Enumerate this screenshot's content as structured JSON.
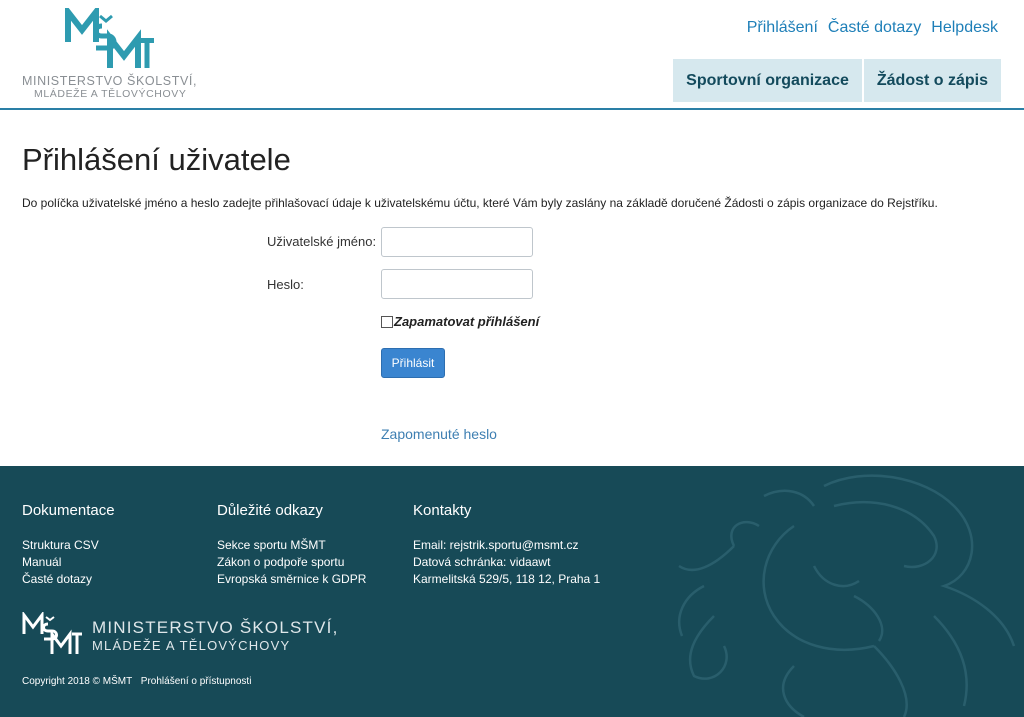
{
  "colors": {
    "accent": "#2a7fa6",
    "tab_bg": "#d6e8ee",
    "tab_text": "#134a5c",
    "button": "#3a85d0",
    "footer_bg": "#174a57"
  },
  "logo": {
    "mark_text": "MŠMT",
    "line1": "MINISTERSTVO ŠKOLSTVÍ,",
    "line2": "MLÁDEŽE A TĚLOVÝCHOVY"
  },
  "top_links": [
    "Přihlášení",
    "Časté dotazy",
    "Helpdesk"
  ],
  "tabs": [
    "Sportovní organizace",
    "Žádost o zápis"
  ],
  "main": {
    "title": "Přihlášení uživatele",
    "intro": "Do políčka uživatelské jméno a heslo zadejte přihlašovací údaje k uživatelskému účtu, které Vám byly zaslány na základě doručené Žádosti o zápis organizace do Rejstříku.",
    "username_label": "Uživatelské jméno:",
    "username_value": "",
    "password_label": "Heslo:",
    "password_value": "",
    "remember_label": "Zapamatovat přihlášení",
    "remember_checked": false,
    "login_button": "Přihlásit",
    "forgot_link": "Zapomenuté heslo"
  },
  "footer": {
    "columns": [
      {
        "heading": "Dokumentace",
        "links": [
          "Struktura CSV",
          "Manuál",
          "Časté dotazy"
        ]
      },
      {
        "heading": "Důležité odkazy",
        "links": [
          "Sekce sportu MŠMT",
          "Zákon o podpoře sportu",
          "Evropská směrnice k GDPR"
        ]
      },
      {
        "heading": "Kontakty",
        "links": [
          "Email: rejstrik.sportu@msmt.cz",
          "Datová schránka: vidaawt",
          "Karmelitská 529/5, 118 12, Praha 1"
        ]
      }
    ],
    "logo_line1": "MINISTERSTVO ŠKOLSTVÍ,",
    "logo_line2": "MLÁDEŽE A TĚLOVÝCHOVY",
    "copyright": "Copyright 2018 © MŠMT",
    "accessibility_link": "Prohlášení o přístupnosti",
    "emblem_icon": "czech-lion-emblem-icon"
  }
}
